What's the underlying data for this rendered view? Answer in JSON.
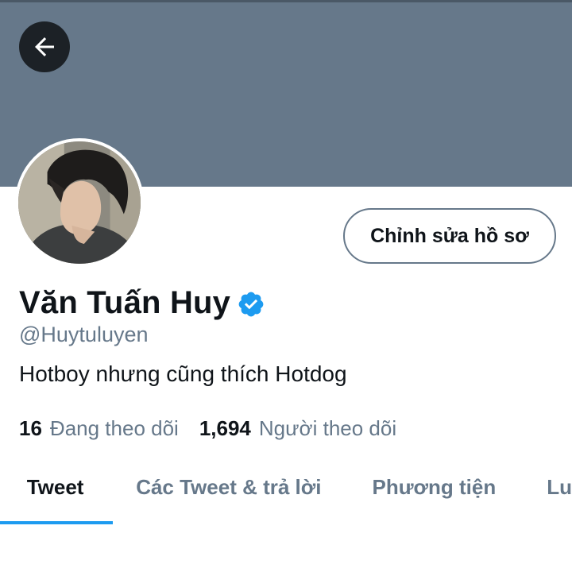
{
  "header": {
    "back_icon": "arrow-left-icon",
    "banner_color": "#66788a"
  },
  "profile": {
    "avatar_icon": "profile-photo",
    "edit_button_label": "Chỉnh sửa hồ sơ",
    "display_name": "Văn Tuấn Huy",
    "verified_icon": "verified-badge-icon",
    "verified_color": "#1d9bf0",
    "handle": "@Huytuluyen",
    "bio": "Hotboy nhưng cũng thích Hotdog"
  },
  "stats": {
    "following_count": "16",
    "following_label": "Đang theo dõi",
    "followers_count": "1,694",
    "followers_label": "Người theo dõi"
  },
  "tabs": [
    {
      "label": "Tweet",
      "active": true
    },
    {
      "label": "Các Tweet & trả lời",
      "active": false
    },
    {
      "label": "Phương tiện",
      "active": false
    },
    {
      "label": "Lu",
      "active": false
    }
  ],
  "colors": {
    "accent": "#1d9bf0",
    "muted_text": "#66788a",
    "primary_text": "#0f1419"
  }
}
